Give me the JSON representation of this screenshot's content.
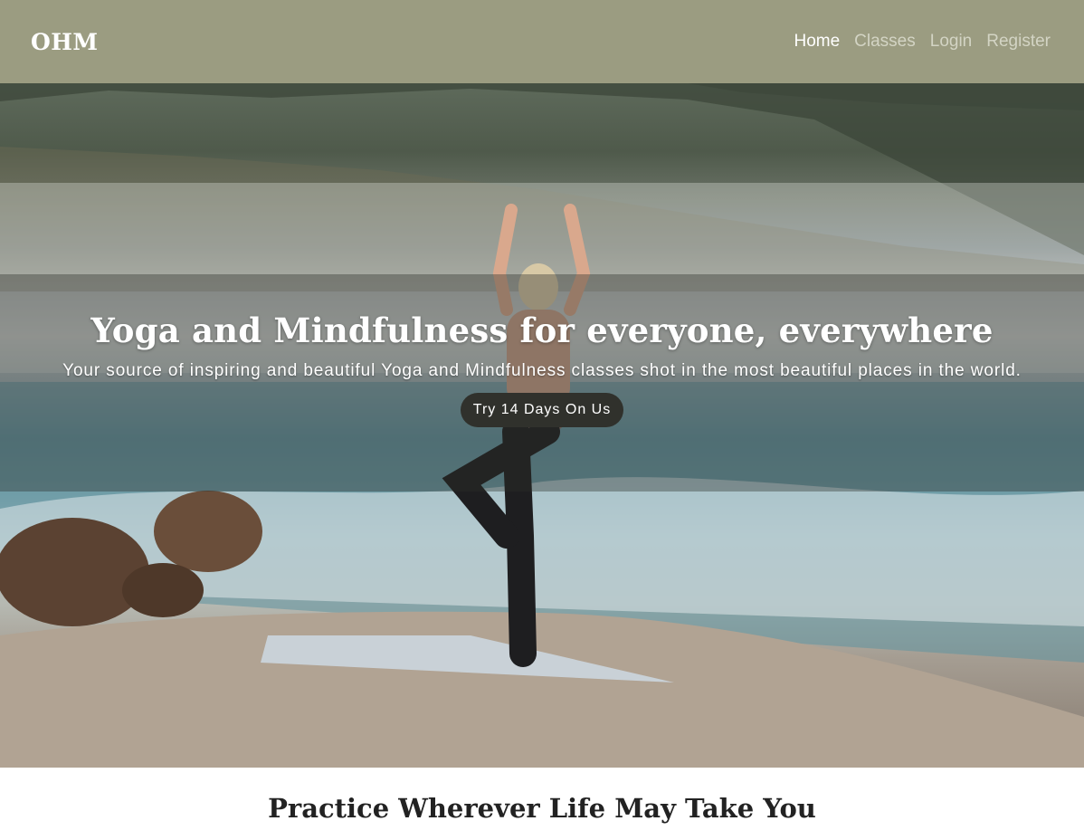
{
  "nav": {
    "brand": "OHM",
    "links": [
      {
        "label": "Home",
        "active": true
      },
      {
        "label": "Classes",
        "active": false
      },
      {
        "label": "Login",
        "active": false
      },
      {
        "label": "Register",
        "active": false
      }
    ]
  },
  "hero": {
    "title": "Yoga and Mindfulness for everyone, everywhere",
    "subtitle": "Your source of inspiring and beautiful Yoga and Mindfulness classes shot in the most beautiful places in the world.",
    "cta_label": "Try 14 Days On Us"
  },
  "section": {
    "title": "Practice Wherever Life May Take You"
  },
  "colors": {
    "navbar_bg": "#9b9c81",
    "nav_active": "#ffffff",
    "nav_inactive": "#d3d4c4",
    "cta_bg": "#30312c"
  }
}
